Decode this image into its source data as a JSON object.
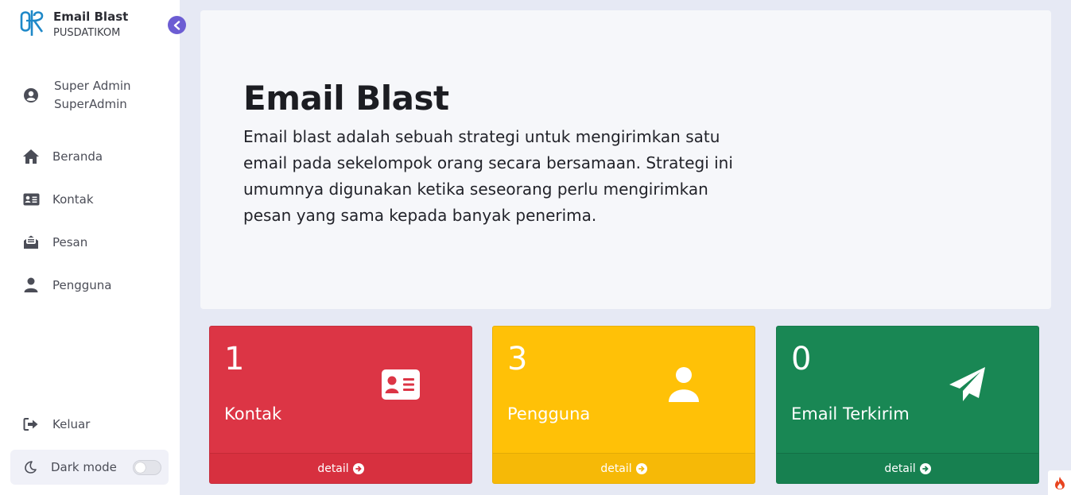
{
  "brand": {
    "title": "Email Blast",
    "subtitle": "PUSDATIKOM"
  },
  "user": {
    "name": "Super Admin",
    "role": "SuperAdmin"
  },
  "nav": {
    "home": "Beranda",
    "contacts": "Kontak",
    "messages": "Pesan",
    "users": "Pengguna",
    "logout": "Keluar",
    "dark_mode": "Dark mode"
  },
  "hero": {
    "title": "Email Blast",
    "description": "Email blast adalah sebuah strategi untuk mengirimkan satu email pada sekelompok orang secara bersamaan. Strategi ini umumnya digunakan ketika seseorang perlu mengirimkan pesan yang sama kepada banyak penerima."
  },
  "cards": [
    {
      "count": "1",
      "label": "Kontak",
      "detail": "detail",
      "icon": "id-card-icon",
      "color": "#dc3545"
    },
    {
      "count": "3",
      "label": "Pengguna",
      "detail": "detail",
      "icon": "user-icon",
      "color": "#ffc107"
    },
    {
      "count": "0",
      "label": "Email Terkirim",
      "detail": "detail",
      "icon": "paper-plane-icon",
      "color": "#198754"
    }
  ],
  "colors": {
    "accent": "#6c5dd3",
    "background": "#e6e9f4",
    "brand_logo": "#1e88c8"
  }
}
